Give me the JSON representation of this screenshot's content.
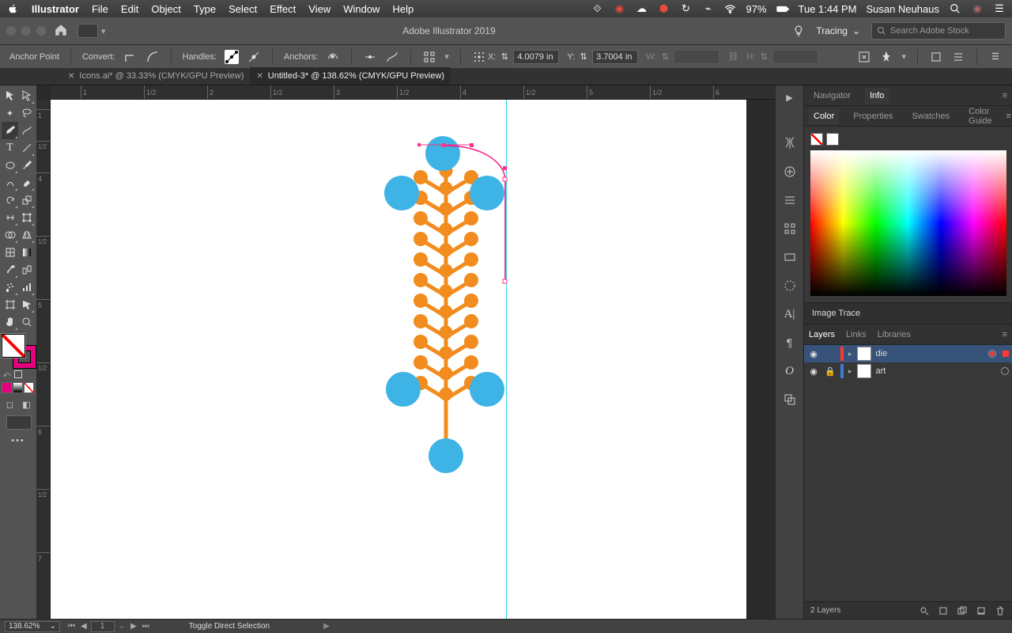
{
  "os_menu": {
    "app": "Illustrator",
    "items": [
      "File",
      "Edit",
      "Object",
      "Type",
      "Select",
      "Effect",
      "View",
      "Window",
      "Help"
    ],
    "battery": "97%",
    "time": "Tue 1:44 PM",
    "user": "Susan Neuhaus"
  },
  "apptop": {
    "title": "Adobe Illustrator 2019",
    "workspace": "Tracing",
    "search_placeholder": "Search Adobe Stock"
  },
  "ctrl": {
    "label": "Anchor Point",
    "convert": "Convert:",
    "handles": "Handles:",
    "anchors": "Anchors:",
    "x_lbl": "X:",
    "x": "4.0079 in",
    "y_lbl": "Y:",
    "y": "3.7004 in",
    "w_lbl": "W:",
    "h_lbl": "H:"
  },
  "tabs": [
    {
      "label": "Icons.ai* @ 33.33% (CMYK/GPU Preview)",
      "active": false
    },
    {
      "label": "Untitled-3* @ 138.62% (CMYK/GPU Preview)",
      "active": true
    }
  ],
  "ruler_h": [
    {
      "p": 38,
      "t": "1"
    },
    {
      "p": 118,
      "t": "1/2"
    },
    {
      "p": 198,
      "t": "2"
    },
    {
      "p": 278,
      "t": "1/2"
    },
    {
      "p": 358,
      "t": "3"
    },
    {
      "p": 438,
      "t": "1/2"
    },
    {
      "p": 518,
      "t": "4"
    },
    {
      "p": 598,
      "t": "1/2"
    },
    {
      "p": 678,
      "t": "5"
    },
    {
      "p": 758,
      "t": "1/2"
    },
    {
      "p": 838,
      "t": "6"
    }
  ],
  "ruler_v": [
    {
      "p": 12,
      "t": "1"
    },
    {
      "p": 52,
      "t": "1/2"
    },
    {
      "p": 92,
      "t": "4"
    },
    {
      "p": 172,
      "t": "1/2"
    },
    {
      "p": 252,
      "t": "5"
    },
    {
      "p": 332,
      "t": "1/2"
    },
    {
      "p": 412,
      "t": "6"
    },
    {
      "p": 492,
      "t": "1/2"
    },
    {
      "p": 572,
      "t": "7"
    }
  ],
  "nav_tabs": [
    "Navigator",
    "Info"
  ],
  "color_tabs": [
    "Color",
    "Properties",
    "Swatches",
    "Color Guide"
  ],
  "trace": "Image Trace",
  "layer_tabs": [
    "Layers",
    "Links",
    "Libraries"
  ],
  "layers": [
    {
      "name": "die",
      "color": "#ff392e",
      "sel": true,
      "locked": false
    },
    {
      "name": "art",
      "color": "#3b7bd1",
      "sel": false,
      "locked": true
    }
  ],
  "layers_footer": "2 Layers",
  "status": {
    "zoom": "138.62%",
    "artboard": "1",
    "msg": "Toggle Direct Selection"
  }
}
